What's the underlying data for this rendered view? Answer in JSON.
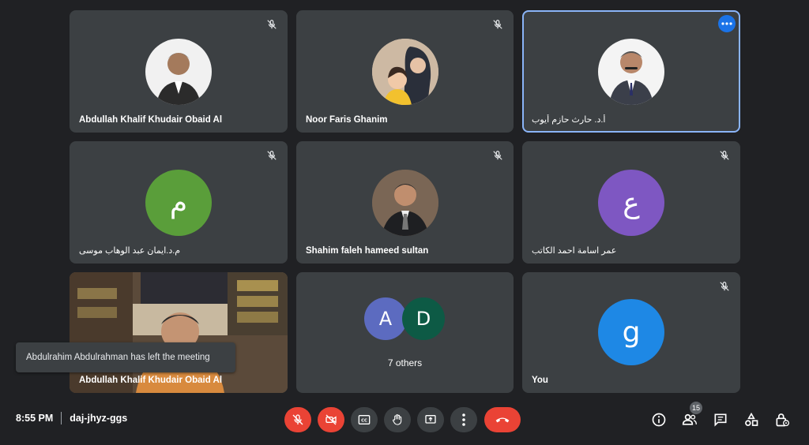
{
  "tiles": [
    {
      "name": "Abdullah Khalif Khudair Obaid Al"
    },
    {
      "name": "Noor Faris Ghanim"
    },
    {
      "name": "أ.د. حارث حازم أيوب"
    },
    {
      "name": "م.د.ايمان عبد الوهاب موسى",
      "initial": "م"
    },
    {
      "name": "Shahim faleh hameed sultan"
    },
    {
      "name": "عمر اسامة احمد الكاتب",
      "initial": "ع"
    },
    {
      "name": "Abdullah Khalif Khudair Obaid Al"
    },
    {
      "others_label": "7 others",
      "initial_a": "A",
      "initial_b": "D"
    },
    {
      "name": "You",
      "initial": "g"
    }
  ],
  "colors": {
    "avatar_green": "#5a9e3a",
    "avatar_purple": "#7e57c2",
    "avatar_blue": "#1e88e5",
    "avatar_slate": "#5c6bc0",
    "avatar_darkgreen": "#0d5a45",
    "danger": "#ea4335"
  },
  "toast": {
    "text": "Abdulrahim Abdulrahman has left the meeting"
  },
  "footer": {
    "time": "8:55 PM",
    "meeting_code": "daj-jhyz-ggs",
    "participants_count": "15"
  },
  "icons": [
    "mic-off-icon",
    "camera-off-icon",
    "captions-icon",
    "raise-hand-icon",
    "present-icon",
    "more-vert-icon",
    "hang-up-icon",
    "info-icon",
    "people-icon",
    "chat-icon",
    "activities-icon",
    "host-controls-icon"
  ]
}
